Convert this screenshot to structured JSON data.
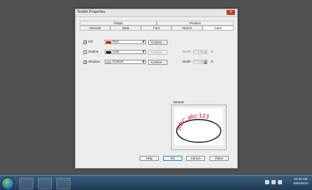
{
  "dialog": {
    "title": "TextArt Properties",
    "close_label": "×",
    "tabs_top": [
      "Shape",
      "Position"
    ],
    "tabs_bottom": [
      "General",
      "Data",
      "Font",
      "TextArt",
      "Color"
    ],
    "active_tab": "Color"
  },
  "fill": {
    "label": "Fill",
    "checked": true,
    "value": "Red",
    "swatch_color": "#d40000",
    "custom_label": "Custom..."
  },
  "outline": {
    "label": "Outline",
    "checked": false,
    "value": "Auto",
    "swatch_color": "#000000",
    "custom_label": "Custom...",
    "width_label": "Width:",
    "width_value": "0.000",
    "unit": "in"
  },
  "shadow": {
    "label": "Shadow",
    "checked": true,
    "value": "Custom",
    "swatch_color": "#bdbdbd",
    "custom_label": "Custom...",
    "width_label": "Width:",
    "width_value": "0.000",
    "unit": "in"
  },
  "sample": {
    "label": "Sample",
    "text": "ABC abc 123",
    "text_color": "#d40000"
  },
  "buttons": {
    "help": "Help",
    "ok": "OK",
    "cancel": "Cancel",
    "place": "Place"
  },
  "taskbar": {
    "time": "10:10 AM",
    "date": "9/30/2010"
  },
  "colors": {
    "desktop": "#505050",
    "dialog_bg": "#ededed",
    "accent": "#3c7fb1"
  }
}
